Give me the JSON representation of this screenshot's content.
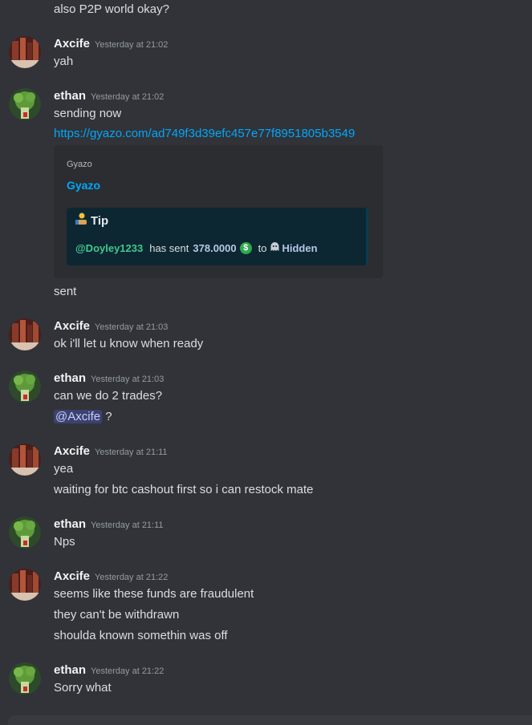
{
  "messages": {
    "m0": {
      "text": "also P2P world okay?"
    },
    "m1": {
      "author": "Axcife",
      "time": "Yesterday at 21:02",
      "l1": "yah"
    },
    "m2": {
      "author": "ethan",
      "time": "Yesterday at 21:02",
      "l1": "sending now",
      "link": "https://gyazo.com/ad749f3d39efc457e77f8951805b3549",
      "embed": {
        "provider": "Gyazo",
        "title": "Gyazo",
        "tip_title": "Tip",
        "tip_sender": "@Doyley1233",
        "tip_has_sent": "has sent",
        "tip_amount": "378.0000",
        "tip_currency_icon": "$",
        "tip_to": "to",
        "tip_recipient": "Hidden"
      },
      "l2": "sent"
    },
    "m3": {
      "author": "Axcife",
      "time": "Yesterday at 21:03",
      "l1": "ok i'll let u know when ready"
    },
    "m4": {
      "author": "ethan",
      "time": "Yesterday at 21:03",
      "l1": "can we do 2 trades?",
      "mention": "@Axcife",
      "after_mention": "?"
    },
    "m5": {
      "author": "Axcife",
      "time": "Yesterday at 21:11",
      "l1": "yea",
      "l2": "waiting for btc cashout first so i can restock mate"
    },
    "m6": {
      "author": "ethan",
      "time": "Yesterday at 21:11",
      "l1": "Nps"
    },
    "m7": {
      "author": "Axcife",
      "time": "Yesterday at 21:22",
      "l1": "seems like these funds are fraudulent",
      "l2": "they can't be withdrawn",
      "l3": "shoulda known somethin was off"
    },
    "m8": {
      "author": "ethan",
      "time": "Yesterday at 21:22",
      "l1": "Sorry what"
    }
  },
  "colors": {
    "background": "#313338",
    "link": "#00a8fc",
    "tip_sender": "#43c68c",
    "mention_bg": "#3c4270"
  }
}
